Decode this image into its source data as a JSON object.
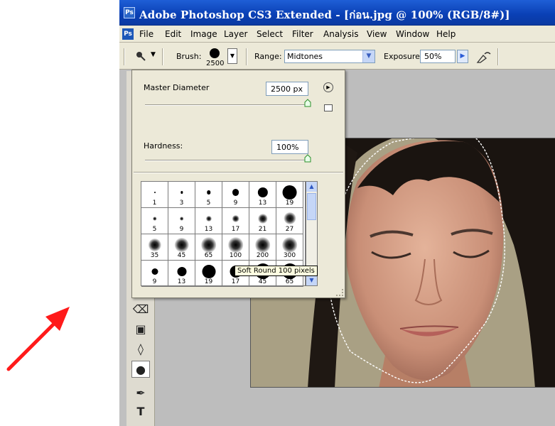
{
  "window": {
    "title": "Adobe Photoshop CS3 Extended - [ก่อน.jpg @ 100% (RGB/8#)]",
    "app_icon": "Ps"
  },
  "menubar": {
    "items": [
      "File",
      "Edit",
      "Image",
      "Layer",
      "Select",
      "Filter",
      "Analysis",
      "View",
      "Window",
      "Help"
    ]
  },
  "options_bar": {
    "brush_label": "Brush:",
    "brush_size": "2500",
    "range_label": "Range:",
    "range_value": "Midtones",
    "exposure_label": "Exposure:",
    "exposure_value": "50%"
  },
  "brush_picker": {
    "master_diameter_label": "Master Diameter",
    "master_diameter_value": "2500 px",
    "master_diameter_level": 1.0,
    "hardness_label": "Hardness:",
    "hardness_value": "100%",
    "hardness_level": 1.0,
    "presets": [
      [
        "1",
        "3",
        "5",
        "9",
        "13",
        "19"
      ],
      [
        "5",
        "9",
        "13",
        "17",
        "21",
        "27"
      ],
      [
        "35",
        "45",
        "65",
        "100",
        "200",
        "300"
      ],
      [
        "9",
        "13",
        "19",
        "17",
        "45",
        "65"
      ]
    ],
    "tooltip": "Soft Round 100 pixels"
  },
  "colors": {
    "arrow": "#ff1a1a",
    "titlebar": "#0a3fb4",
    "selection": "#ffffff"
  }
}
